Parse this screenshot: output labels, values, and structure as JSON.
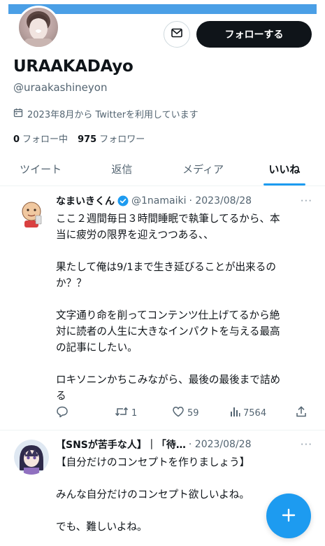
{
  "profile": {
    "display_name": "URAAKADAyo",
    "handle": "@uraakashineyon",
    "joined": "2023年8月から Twitterを利用しています",
    "following_count": "0",
    "following_label": "フォロー中",
    "followers_count": "975",
    "followers_label": "フォロワー"
  },
  "header": {
    "follow_label": "フォローする"
  },
  "tabs": [
    {
      "label": "ツイート"
    },
    {
      "label": "返信"
    },
    {
      "label": "メディア"
    },
    {
      "label": "いいね"
    }
  ],
  "active_tab": "いいね",
  "tweets": [
    {
      "name": "なまいきくん",
      "handle": "@1namaiki",
      "date": "· 2023/08/28",
      "lines": [
        "ここ２週間毎日３時間睡眠で執筆してるから、本",
        "当に疲労の限界を迎えつつある、、",
        "",
        "果たして俺は9/1まで生き延びることが出来るの",
        "か？？",
        "",
        "文字通り命を削ってコンテンツ仕上げてるから絶",
        "対に読者の人生に大きなインパクトを与える最高",
        "の記事にしたい。",
        "",
        "ロキソニンかちこみながら、最後の最後まで詰め",
        "る"
      ],
      "retweets": "1",
      "likes": "59",
      "views": "7564"
    },
    {
      "name": "【SNSが苦手な人】｜「待…",
      "date": "· 2023/08/28",
      "lines": [
        "【自分だけのコンセプトを作りましょう】",
        "",
        "みんな自分だけのコンセプト欲しいよね。",
        "",
        "でも、難しいよね。"
      ]
    }
  ],
  "colors": {
    "accent": "#1d9bf0",
    "banner": "#4a9fe6",
    "text": "#0f1419",
    "muted": "#536471"
  },
  "icons": [
    "mail-icon",
    "calendar-icon",
    "verified-badge-icon",
    "reply-icon",
    "retweet-icon",
    "like-icon",
    "views-icon",
    "share-icon",
    "more-icon",
    "compose-plus-icon"
  ]
}
